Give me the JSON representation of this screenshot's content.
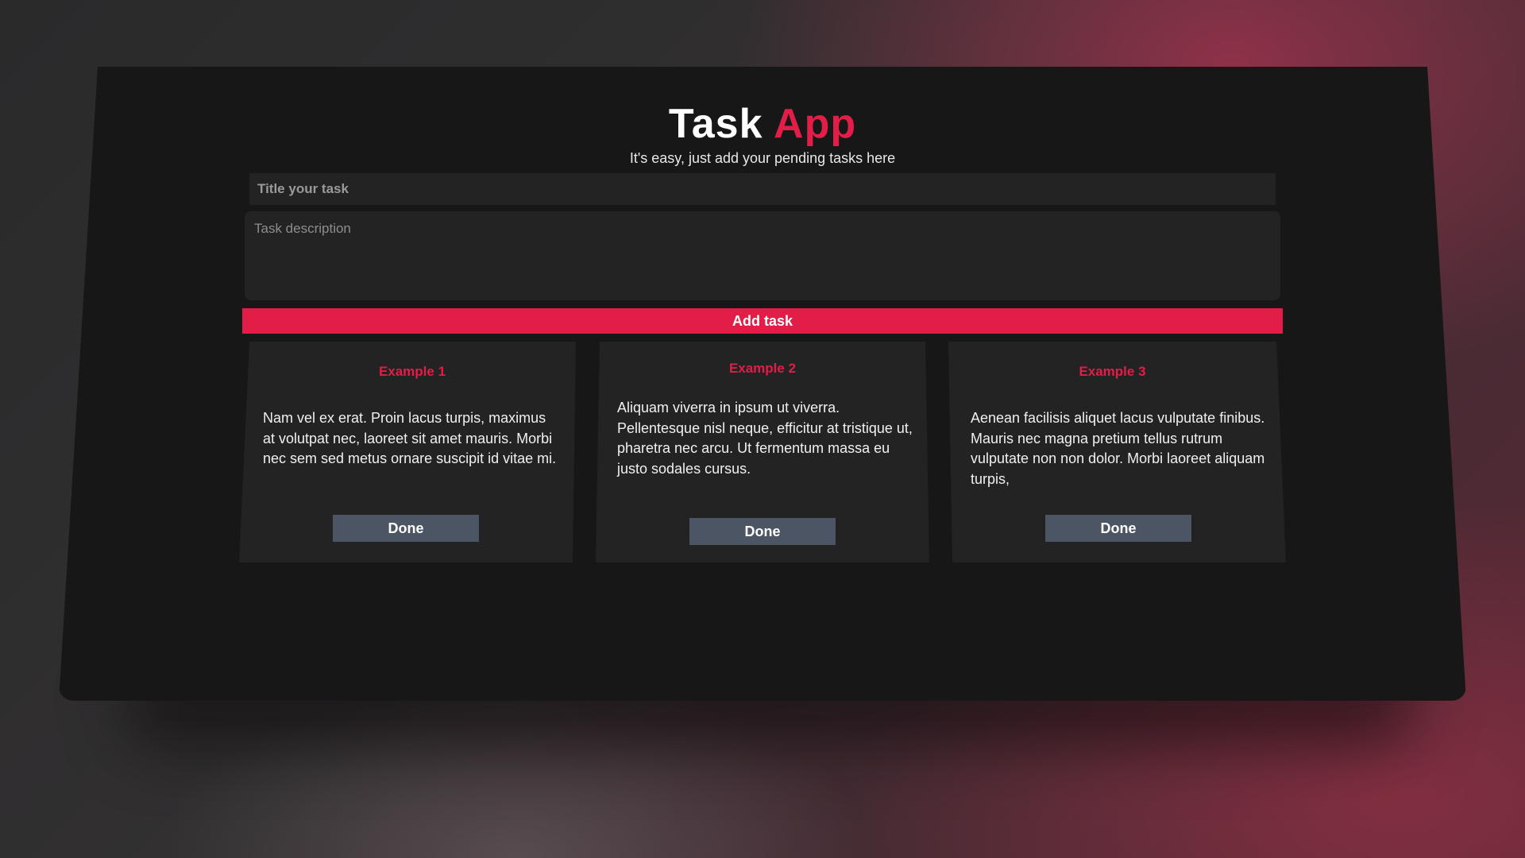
{
  "app": {
    "title_main": "Task",
    "title_accent": "App",
    "subtitle": "It's easy, just add your pending tasks here"
  },
  "form": {
    "title_placeholder": "Title your task",
    "title_value": "",
    "description_placeholder": "Task description",
    "description_value": "",
    "add_label": "Add task"
  },
  "tasks": [
    {
      "title": "Example 1",
      "description": "Nam vel ex erat. Proin lacus turpis, maximus at volutpat nec, laoreet sit amet mauris. Morbi nec sem sed metus ornare suscipit id vitae mi.",
      "done_label": "Done"
    },
    {
      "title": "Example 2",
      "description": "Aliquam viverra in ipsum ut viverra. Pellentesque nisl neque, efficitur at tristique ut, pharetra nec arcu. Ut fermentum massa eu justo sodales cursus.",
      "done_label": "Done"
    },
    {
      "title": "Example 3",
      "description": "Aenean facilisis aliquet lacus vulputate finibus. Mauris nec magna pretium tellus rutrum vulputate non non dolor. Morbi laoreet aliquam turpis,",
      "done_label": "Done"
    }
  ],
  "colors": {
    "accent": "#e11d48",
    "panel": "#171717",
    "card": "#232323",
    "done_button": "#4b5563"
  }
}
